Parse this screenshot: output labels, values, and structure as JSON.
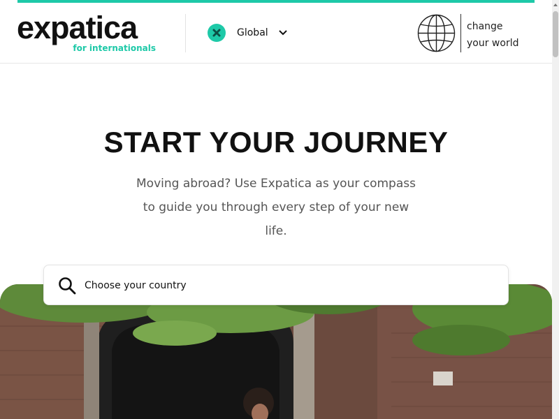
{
  "brand": {
    "name": "expatica",
    "tagline": "for internationals",
    "accent_color": "#1ec9a8"
  },
  "header": {
    "region_label": "Global",
    "region_icon": "x-close-icon",
    "dropdown_icon": "chevron-down-icon",
    "globe_icon": "globe-icon",
    "change_world_line1": "change",
    "change_world_line2": "your world"
  },
  "hero": {
    "title": "START YOUR JOURNEY",
    "subtitle": "Moving abroad? Use Expatica as your compass to guide you through every step of your new life."
  },
  "search": {
    "placeholder": "Choose your country",
    "icon": "search-icon"
  }
}
